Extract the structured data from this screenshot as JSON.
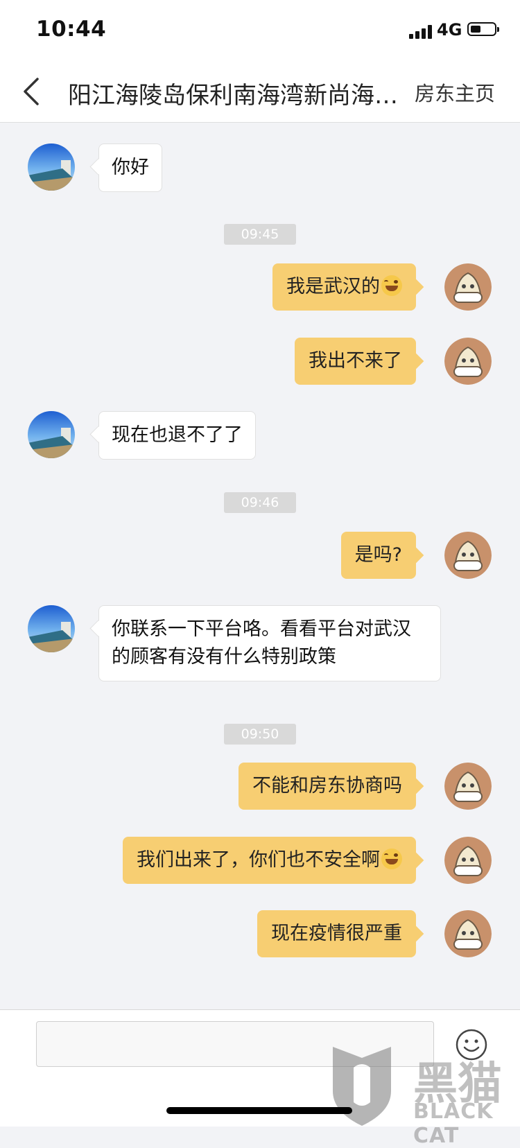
{
  "status_bar": {
    "time": "10:44",
    "network": "4G"
  },
  "nav": {
    "title": "阳江海陵岛保利南海湾新尚海…",
    "action": "房东主页"
  },
  "messages": {
    "m1": "你好",
    "t1": "09:45",
    "m2": "我是武汉的",
    "m3": "我出不来了",
    "m4": "现在也退不了了",
    "t2": "09:46",
    "m5": "是吗?",
    "m6_line1": "你联系一下平台咯。看看平台对武汉",
    "m6_line2": "的顾客有没有什么特别政策",
    "t3": "09:50",
    "m7": "不能和房东协商吗",
    "m8": "我们出来了，你们也不安全啊",
    "m9": "现在疫情很严重"
  },
  "input": {
    "value": "",
    "placeholder": ""
  },
  "watermark": {
    "cn": "黑猫",
    "en": "BLACK CAT"
  },
  "colors": {
    "outgoing_bubble": "#f7ce72",
    "incoming_bubble": "#ffffff",
    "background": "#f2f3f6"
  },
  "icons": {
    "back": "chevron-left-icon",
    "emoji": "smiley-icon",
    "tears_of_joy": "face-with-tears-of-joy"
  }
}
